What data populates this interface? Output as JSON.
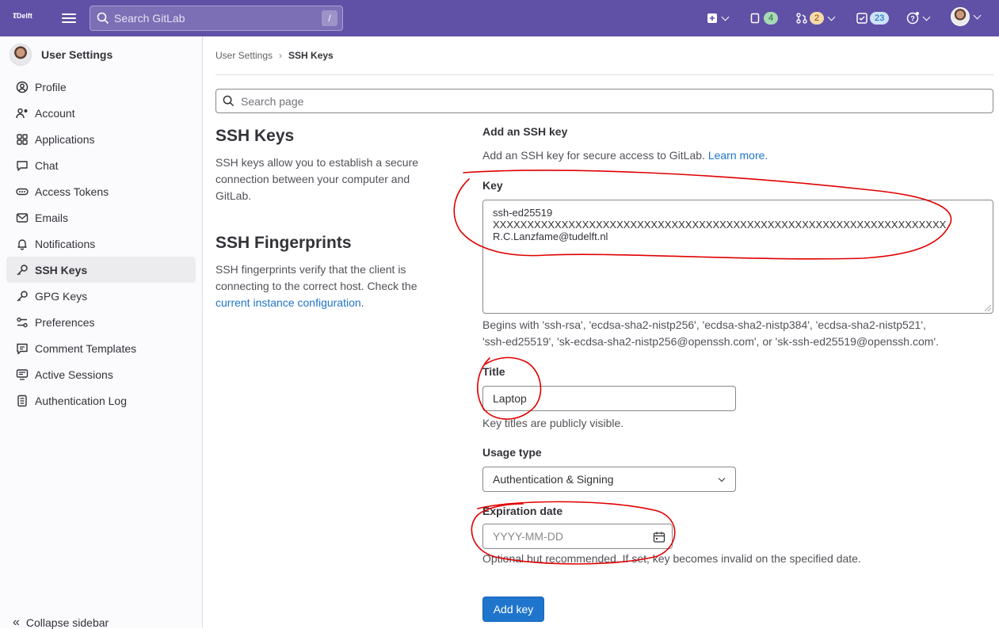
{
  "topbar": {
    "logo_text": "Delft",
    "search_placeholder": "Search GitLab",
    "search_shortcut": "/",
    "issues_count": "4",
    "merge_requests_count": "2",
    "todos_count": "23"
  },
  "sidebar": {
    "title": "User Settings",
    "items": [
      {
        "label": "Profile",
        "icon": "profile-icon"
      },
      {
        "label": "Account",
        "icon": "account-icon"
      },
      {
        "label": "Applications",
        "icon": "applications-icon"
      },
      {
        "label": "Chat",
        "icon": "chat-icon"
      },
      {
        "label": "Access Tokens",
        "icon": "token-icon"
      },
      {
        "label": "Emails",
        "icon": "mail-icon"
      },
      {
        "label": "Notifications",
        "icon": "bell-icon"
      },
      {
        "label": "SSH Keys",
        "icon": "key-icon",
        "active": true
      },
      {
        "label": "GPG Keys",
        "icon": "key-icon"
      },
      {
        "label": "Preferences",
        "icon": "preferences-icon"
      },
      {
        "label": "Comment Templates",
        "icon": "comment-icon"
      },
      {
        "label": "Active Sessions",
        "icon": "monitor-icon"
      },
      {
        "label": "Authentication Log",
        "icon": "log-icon"
      }
    ],
    "collapse_label": "Collapse sidebar"
  },
  "breadcrumb": {
    "parent": "User Settings",
    "current": "SSH Keys"
  },
  "page_search_placeholder": "Search page",
  "ssh_section": {
    "title": "SSH Keys",
    "description": "SSH keys allow you to establish a secure connection between your computer and GitLab."
  },
  "fingerprint_section": {
    "title": "SSH Fingerprints",
    "description": "SSH fingerprints verify that the client is connecting to the correct host. Check the",
    "link": "current instance configuration",
    "suffix": "."
  },
  "form": {
    "title": "Add an SSH key",
    "description": "Add an SSH key for secure access to GitLab.",
    "learn_more": "Learn more.",
    "key_label": "Key",
    "key_lines": [
      "ssh-ed25519",
      "XXXXXXXXXXXXXXXXXXXXXXXXXXXXXXXXXXXXXXXXXXXXXXXXXXXXXXXXXXXXXXXXXX",
      "R.C.Lanzfame@tudelft.nl"
    ],
    "key_help_1": "Begins with 'ssh-rsa', 'ecdsa-sha2-nistp256', 'ecdsa-sha2-nistp384', 'ecdsa-sha2-nistp521',",
    "key_help_2": "'ssh-ed25519', 'sk-ecdsa-sha2-nistp256@openssh.com', or 'sk-ssh-ed25519@openssh.com'.",
    "title_label": "Title",
    "title_value": "Laptop",
    "title_help": "Key titles are publicly visible.",
    "usage_label": "Usage type",
    "usage_value": "Authentication & Signing",
    "expiration_label": "Expiration date",
    "expiration_placeholder": "YYYY-MM-DD",
    "expiration_help": "Optional but recommended. If set, key becomes invalid on the specified date.",
    "submit_label": "Add key"
  },
  "colors": {
    "topbar": "#6050a6",
    "annotation": "#e00000",
    "primary": "#1f75cb"
  }
}
